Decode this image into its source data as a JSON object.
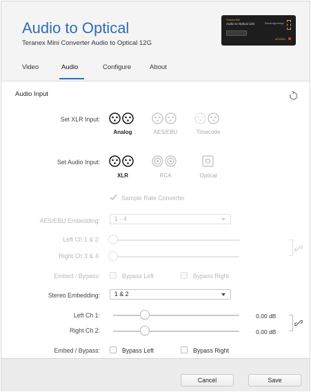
{
  "header": {
    "title": "Audio to Optical",
    "subtitle": "Teranex Mini Converter Audio to Optical 12G",
    "device": {
      "brand_small": "Teranex Mini",
      "model": "Audio to Optical 12G",
      "maker": "Blackmagicdesign",
      "tag": "AES/EBU"
    }
  },
  "tabs": [
    {
      "label": "Video",
      "active": false
    },
    {
      "label": "Audio",
      "active": true
    },
    {
      "label": "Configure",
      "active": false
    },
    {
      "label": "About",
      "active": false
    }
  ],
  "audio_input": {
    "section_title": "Audio Input",
    "xlr_input": {
      "label": "Set XLR Input:",
      "options": [
        {
          "label": "Analog",
          "selected": true
        },
        {
          "label": "AES/EBU",
          "selected": false
        },
        {
          "label": "Timecode",
          "selected": false
        }
      ]
    },
    "audio_input": {
      "label": "Set Audio Input:",
      "options": [
        {
          "label": "XLR",
          "selected": true
        },
        {
          "label": "RCA",
          "selected": false
        },
        {
          "label": "Optical",
          "selected": false
        }
      ]
    },
    "sample_rate_converter": {
      "label": "Sample Rate Converter",
      "checked": true,
      "enabled": false
    },
    "aes_embedding": {
      "label": "AES/EBU Embedding:",
      "value": "1 - 4",
      "enabled": false
    },
    "aes_left": {
      "label": "Left Ch 1 & 2:",
      "level": 0.0
    },
    "aes_right": {
      "label": "Right Ch 3 & 4:",
      "level": 0.0
    },
    "aes_bypass": {
      "label": "Embed / Bypass:",
      "left": "Bypass Left",
      "right": "Bypass Right"
    },
    "stereo_embedding": {
      "label": "Stereo Embedding:",
      "value": "1 & 2"
    },
    "left_ch": {
      "label": "Left Ch 1:",
      "value": "0.00 dB",
      "level": 0.28
    },
    "right_ch": {
      "label": "Right Ch 2:",
      "value": "0.00 dB",
      "level": 0.28
    },
    "bypass": {
      "label": "Embed / Bypass:",
      "left": "Bypass Left",
      "right": "Bypass Right"
    }
  },
  "footer": {
    "cancel": "Cancel",
    "save": "Save"
  },
  "colors": {
    "accent": "#2e6db4",
    "header_bg": "#f4f4f4",
    "footer_bg": "#ececec"
  }
}
